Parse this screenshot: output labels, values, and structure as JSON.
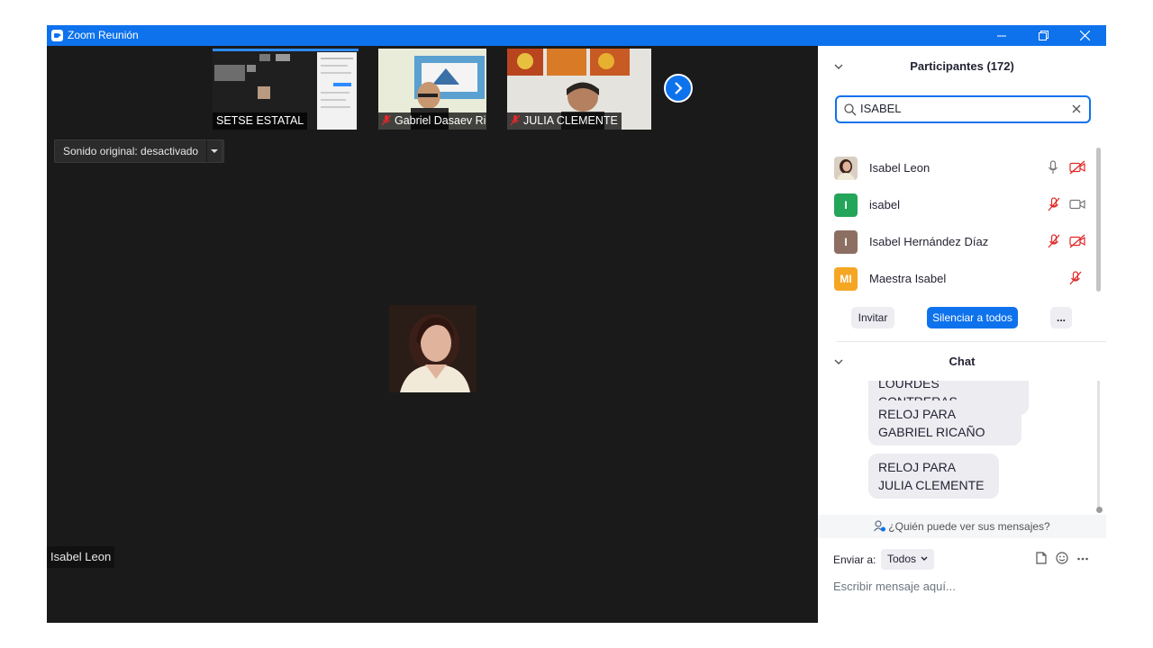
{
  "window": {
    "title": "Zoom Reunión"
  },
  "thumbnails": [
    {
      "name": "SETSE ESTATAL",
      "muted": false
    },
    {
      "name": "Gabriel Dasaev Ricañ...",
      "muted": true
    },
    {
      "name": "JULIA  CLEMENTE",
      "muted": true
    }
  ],
  "sound": {
    "label": "Sonido original: desactivado"
  },
  "speaker": {
    "name": "Isabel Leon"
  },
  "participants": {
    "title": "Participantes (172)",
    "search_value": "ISABEL",
    "items": [
      {
        "name": "Isabel Leon",
        "initials": "",
        "avatar_color": "#8a7a6a",
        "mic": "on",
        "video": "off"
      },
      {
        "name": "isabel",
        "initials": "I",
        "avatar_color": "#23a55a",
        "mic": "off",
        "video": "on"
      },
      {
        "name": "Isabel Hernández Díaz",
        "initials": "I",
        "avatar_color": "#8c6e62",
        "mic": "off",
        "video": "off"
      },
      {
        "name": "Maestra Isabel",
        "initials": "MI",
        "avatar_color": "#f5a623",
        "mic": "off",
        "video": ""
      }
    ],
    "invite_label": "Invitar",
    "mute_all_label": "Silenciar a todos",
    "more_label": "..."
  },
  "chat": {
    "title": "Chat",
    "messages": [
      "LOURDES CONTRERAS",
      "RELOJ PARA  GABRIEL RICAÑO",
      "RELOJ PARA JULIA CLEMENTE"
    ],
    "who_can_see": "¿Quién puede ver sus mensajes?",
    "send_to_label": "Enviar a:",
    "send_to_value": "Todos",
    "input_placeholder": "Escribir mensaje aquí..."
  },
  "colors": {
    "accent": "#0e72ed",
    "muted_red": "#e02828"
  }
}
